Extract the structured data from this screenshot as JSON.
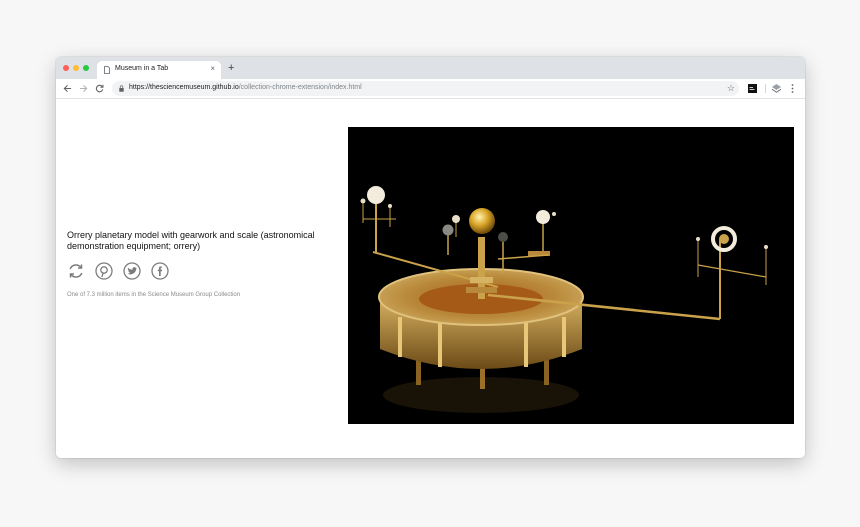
{
  "browser": {
    "tab_title": "Museum in a Tab",
    "tab_close": "×",
    "new_tab": "+",
    "url_host": "https://thesciencemuseum.github.io",
    "url_path": "/collection-chrome-extension/index.html",
    "bookmark": "☆"
  },
  "object": {
    "title": "Orrery planetary model with gearwork and scale (astronomical demonstration equipment; orrery)",
    "caption": "One of 7.3 million items in the Science Museum Group Collection",
    "share_icons": [
      "refresh-icon",
      "pinterest-icon",
      "twitter-icon",
      "facebook-icon"
    ]
  },
  "colors": {
    "background": "#f7f7f7",
    "tabbar": "#dee1e6",
    "photo_background": "#000000",
    "brass": "#c9a24a"
  }
}
